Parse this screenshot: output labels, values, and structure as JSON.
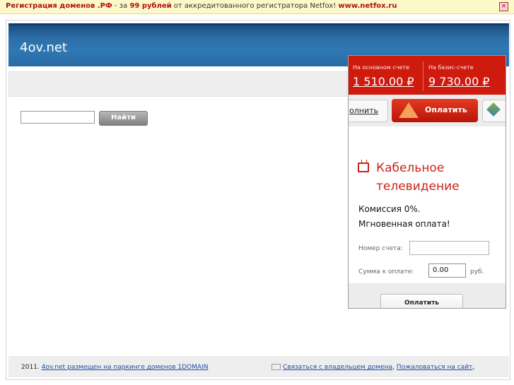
{
  "banner": {
    "part1": "Регистрация доменов .РФ",
    "part2": " - за ",
    "part3": "99 рублей",
    "part4": " от аккредитованного регистратора Netfox! ",
    "part5": "www.netfox.ru",
    "close_symbol": "×"
  },
  "header": {
    "site_name": "4ov.net"
  },
  "search": {
    "value": "",
    "button_label": "Найти"
  },
  "widget": {
    "balance_main_label": "На основном счете",
    "balance_main_value": "1 510.00 ₽",
    "balance_basis_label": "На базис-счете",
    "balance_basis_value": "9 730.00 ₽",
    "nav_left_label": "олнить",
    "nav_pay_label": "Оплатить",
    "title_line1": "Кабельное",
    "title_line2": "телевидение",
    "text_line1": "Комиссия 0%.",
    "text_line2": "Мгновенная оплата!",
    "account_label": "Номер счета:",
    "amount_label": "Сумма к оплате:",
    "amount_value": "0.00",
    "currency": "руб.",
    "submit_label": "Оплатить"
  },
  "footer": {
    "year": "2011.",
    "parking_link": "4ov.net размещен на паркинге доменов 1DOMAIN",
    "contact_link": "Связаться с владельцем домена",
    "separator": ",",
    "complain_link": "Пожаловаться на сайт",
    "end": ","
  }
}
